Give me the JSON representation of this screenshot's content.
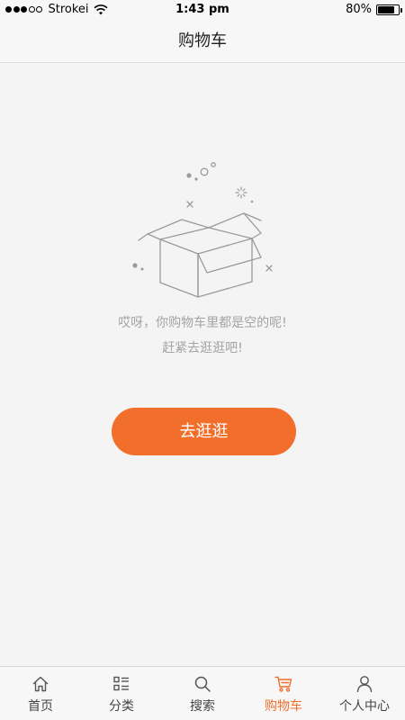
{
  "status_bar": {
    "carrier": "Strokei",
    "time": "1:43 pm",
    "battery_percent": "80%",
    "battery_level": 0.8,
    "signal_bars_filled": 3,
    "signal_bars_total": 5
  },
  "header": {
    "title": "购物车"
  },
  "empty_state": {
    "icon": "empty-box-icon",
    "line1": "哎呀，你购物车里都是空的呢!",
    "line2": "赶紧去逛逛吧!"
  },
  "actions": {
    "go_shopping_label": "去逛逛"
  },
  "colors": {
    "accent": "#f26f2b",
    "background": "#f4f4f4",
    "hint_text": "#a4a4a4"
  },
  "tabs": [
    {
      "label": "首页",
      "icon": "home-icon",
      "active": false
    },
    {
      "label": "分类",
      "icon": "category-list-icon",
      "active": false
    },
    {
      "label": "搜索",
      "icon": "search-icon",
      "active": false
    },
    {
      "label": "购物车",
      "icon": "cart-icon",
      "active": true
    },
    {
      "label": "个人中心",
      "icon": "user-icon",
      "active": false
    }
  ]
}
